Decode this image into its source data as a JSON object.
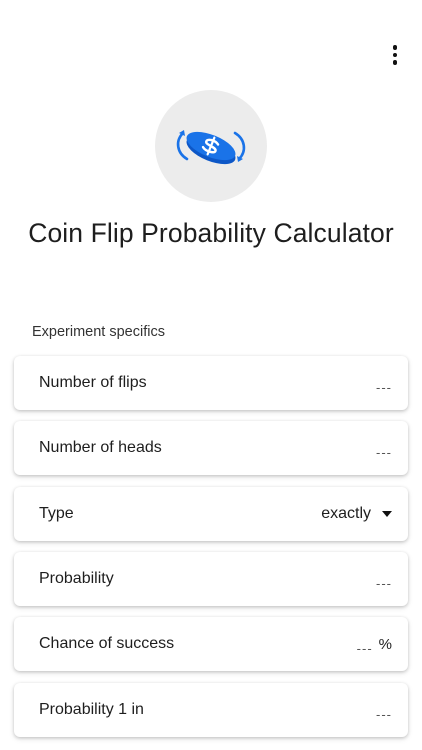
{
  "header": {
    "menu_icon": "more-vert-icon",
    "logo_icon": "coin-flip-icon",
    "title": "Coin Flip Probability Calculator"
  },
  "colors": {
    "accent": "#1a73e8",
    "logo_bg": "#ececec"
  },
  "section": {
    "label": "Experiment specifics"
  },
  "fields": [
    {
      "label": "Number of flips",
      "value": "---"
    },
    {
      "label": "Number of heads",
      "value": "---"
    },
    {
      "label": "Type",
      "value": "exactly"
    },
    {
      "label": "Probability",
      "value": "---"
    },
    {
      "label": "Chance of success",
      "value": "---",
      "unit": "%"
    },
    {
      "label": "Probability 1 in",
      "value": "---"
    }
  ]
}
